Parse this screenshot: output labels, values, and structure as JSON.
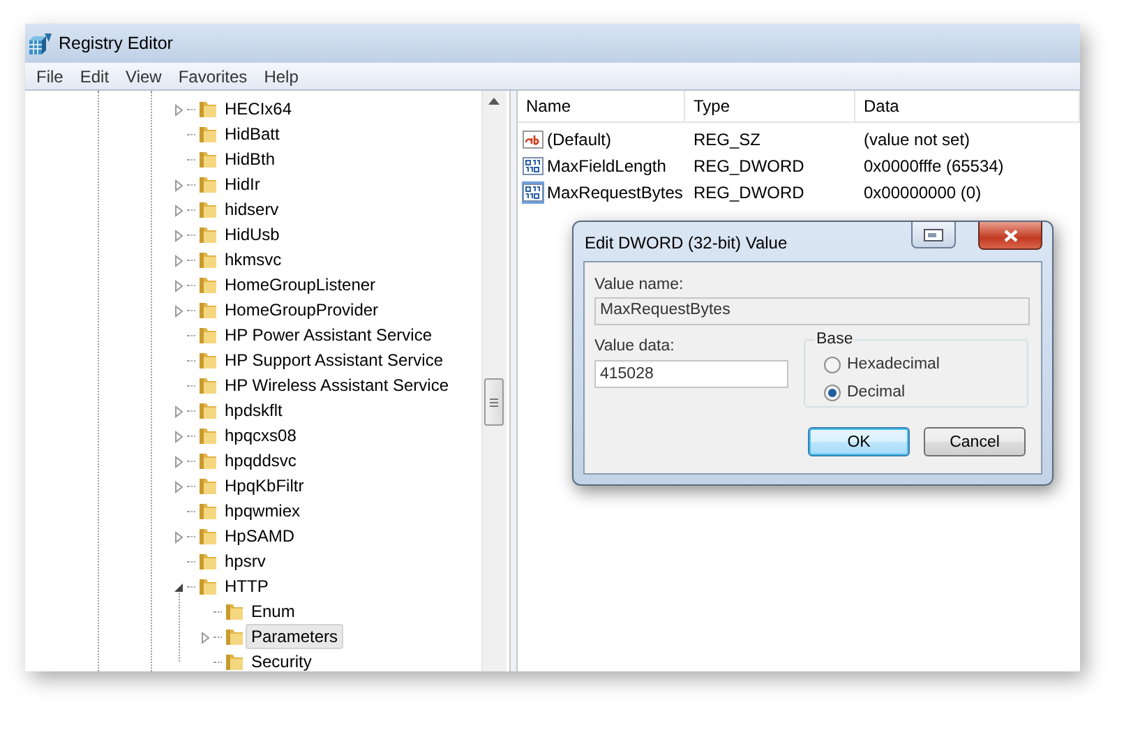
{
  "window": {
    "title": "Registry Editor"
  },
  "menu": [
    "File",
    "Edit",
    "View",
    "Favorites",
    "Help"
  ],
  "tree": [
    {
      "label": "HECIx64",
      "expandable": true,
      "selected": false
    },
    {
      "label": "HidBatt",
      "expandable": false,
      "selected": false
    },
    {
      "label": "HidBth",
      "expandable": false,
      "selected": false
    },
    {
      "label": "HidIr",
      "expandable": true,
      "selected": false
    },
    {
      "label": "hidserv",
      "expandable": true,
      "selected": false
    },
    {
      "label": "HidUsb",
      "expandable": true,
      "selected": false
    },
    {
      "label": "hkmsvc",
      "expandable": true,
      "selected": false
    },
    {
      "label": "HomeGroupListener",
      "expandable": true,
      "selected": false
    },
    {
      "label": "HomeGroupProvider",
      "expandable": true,
      "selected": false
    },
    {
      "label": "HP Power Assistant Service",
      "expandable": false,
      "selected": false
    },
    {
      "label": "HP Support Assistant Service",
      "expandable": false,
      "selected": false
    },
    {
      "label": "HP Wireless Assistant Service",
      "expandable": false,
      "selected": false
    },
    {
      "label": "hpdskflt",
      "expandable": true,
      "selected": false
    },
    {
      "label": "hpqcxs08",
      "expandable": true,
      "selected": false
    },
    {
      "label": "hpqddsvc",
      "expandable": true,
      "selected": false
    },
    {
      "label": "HpqKbFiltr",
      "expandable": true,
      "selected": false
    },
    {
      "label": "hpqwmiex",
      "expandable": false,
      "selected": false
    },
    {
      "label": "HpSAMD",
      "expandable": true,
      "selected": false
    },
    {
      "label": "hpsrv",
      "expandable": false,
      "selected": false
    },
    {
      "label": "HTTP",
      "expandable": true,
      "expanded": true,
      "selected": false,
      "children": [
        {
          "label": "Enum",
          "expandable": false,
          "selected": false
        },
        {
          "label": "Parameters",
          "expandable": true,
          "selected": true
        },
        {
          "label": "Security",
          "expandable": false,
          "selected": false
        }
      ]
    }
  ],
  "values": {
    "columns": [
      "Name",
      "Type",
      "Data"
    ],
    "rows": [
      {
        "kind": "string",
        "name": "(Default)",
        "type": "REG_SZ",
        "data": "(value not set)",
        "selected": false
      },
      {
        "kind": "binary",
        "name": "MaxFieldLength",
        "type": "REG_DWORD",
        "data": "0x0000fffe (65534)",
        "selected": false
      },
      {
        "kind": "binary",
        "name": "MaxRequestBytes",
        "type": "REG_DWORD",
        "data": "0x00000000 (0)",
        "selected": true
      }
    ]
  },
  "dialog": {
    "title": "Edit DWORD (32-bit) Value",
    "value_name_label": "Value name:",
    "value_name": "MaxRequestBytes",
    "value_data_label": "Value data:",
    "value_data": "415028",
    "base_label": "Base",
    "base_options": [
      {
        "label": "Hexadecimal",
        "selected": false
      },
      {
        "label": "Decimal",
        "selected": true
      }
    ],
    "buttons": [
      {
        "label": "OK",
        "default": true
      },
      {
        "label": "Cancel",
        "default": false
      }
    ]
  }
}
